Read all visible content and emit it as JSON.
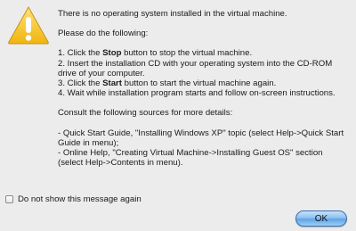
{
  "dialog": {
    "headline": "There is no operating system installed in the virtual machine.",
    "intro": "Please do the following:",
    "steps": [
      {
        "prefix": "1. Click the ",
        "bold": "Stop",
        "suffix": " button to stop the virtual machine."
      },
      {
        "text_line1": "2. Insert the installation CD with your operating system into the CD-ROM",
        "text_line2": "drive of your computer."
      },
      {
        "prefix": "3. Click the ",
        "bold": "Start",
        "suffix": " button to start the virtual machine again."
      },
      {
        "text": "4. Wait while installation program starts and follow on-screen instructions."
      }
    ],
    "consult": "Consult the following sources for more details:",
    "sources": [
      {
        "line1": "- Quick Start Guide, \"Installing Windows XP\" topic (select Help->Quick Start",
        "line2": "Guide in menu);"
      },
      {
        "line1": "- Online Help, \"Creating Virtual Machine->Installing Guest OS\" section",
        "line2": "(select Help->Contents in menu)."
      }
    ],
    "checkbox_label": "Do not show this message again",
    "checkbox_checked": false,
    "ok_label": "OK",
    "icon": "warning-icon",
    "colors": {
      "warning_yellow": "#f7c21a",
      "button_blue": "#5fa4e6"
    }
  }
}
